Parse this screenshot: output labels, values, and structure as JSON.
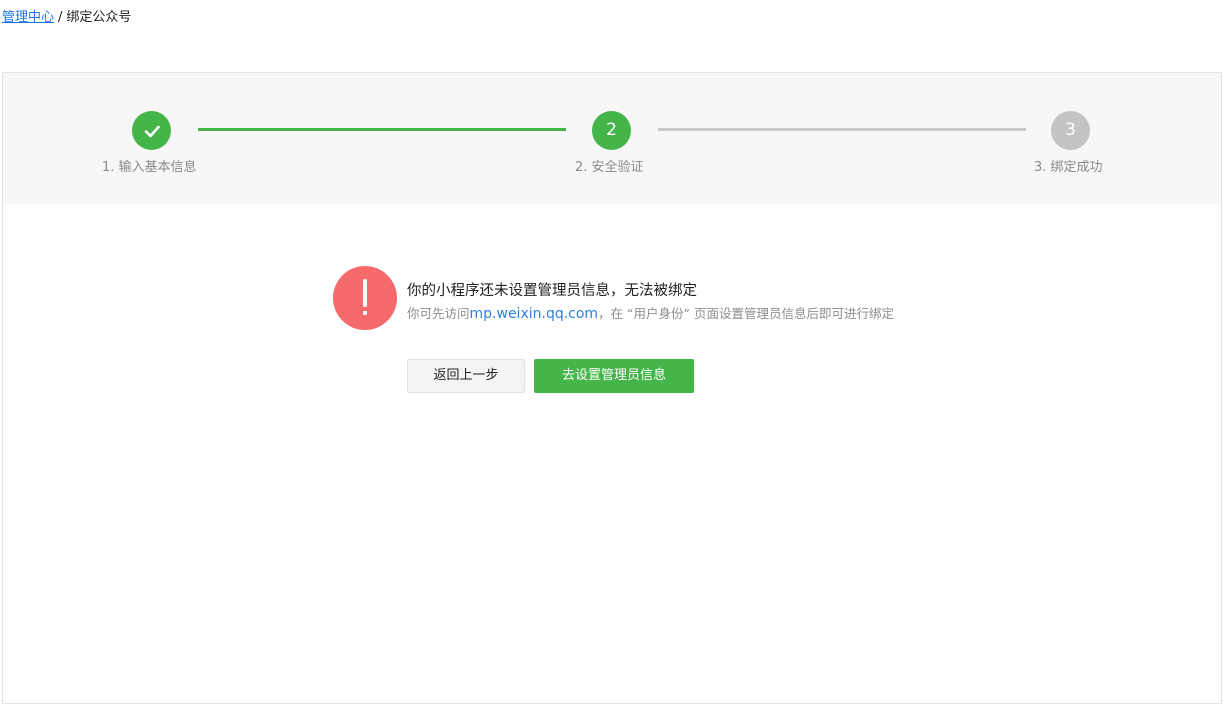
{
  "breadcrumb": {
    "parent": "管理中心",
    "separator": "/",
    "current": "绑定公众号"
  },
  "steps": [
    {
      "number": "1",
      "label": "1. 输入基本信息",
      "status": "done",
      "icon": "check-icon"
    },
    {
      "number": "2",
      "label": "2. 安全验证",
      "status": "active"
    },
    {
      "number": "3",
      "label": "3. 绑定成功",
      "status": "todo"
    }
  ],
  "message": {
    "icon": "exclamation-icon",
    "title": "你的小程序还未设置管理员信息，无法被绑定",
    "desc_prefix": "你可先访问",
    "desc_link": "mp.weixin.qq.com",
    "desc_suffix": "，在 “用户身份” 页面设置管理员信息后即可进行绑定"
  },
  "buttons": {
    "back": "返回上一步",
    "setup": "去设置管理员信息"
  },
  "colors": {
    "green": "#44b549",
    "gray": "#c4c4c4",
    "alert_red": "#f56a6a",
    "link_blue": "#2f7fd6"
  }
}
